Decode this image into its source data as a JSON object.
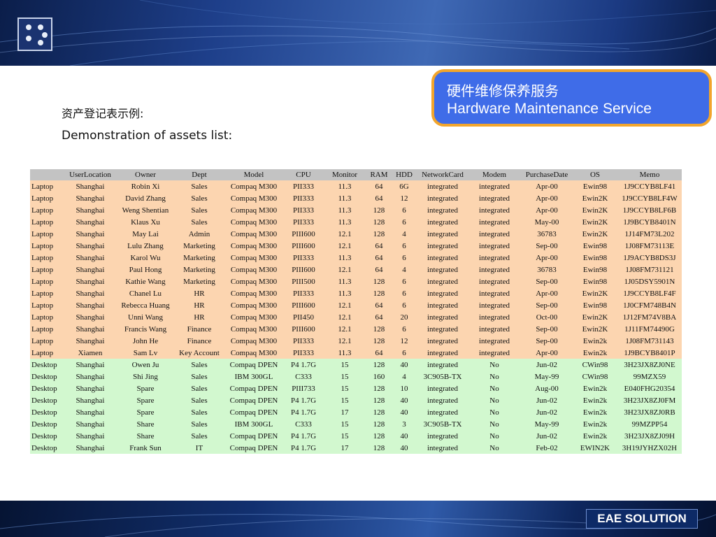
{
  "badge": {
    "title_cn": "硬件维修保养服务",
    "title_en": "Hardware Maintenance Service"
  },
  "intro": {
    "title_cn": "资产登记表示例:",
    "title_en": "Demonstration of assets list:"
  },
  "footer": {
    "brand": "EAE SOLUTION"
  },
  "colors": {
    "laptop_row": "#fcd5b0",
    "desktop_row": "#d2f8cf",
    "header_row": "#c3c3c3",
    "badge_bg": "#3f6ce8",
    "badge_border": "#f2a52c"
  },
  "table": {
    "headers": [
      "",
      "UserLocation",
      "Owner",
      "Dept",
      "Model",
      "CPU",
      "Monitor",
      "RAM",
      "HDD",
      "NetworkCard",
      "Modem",
      "PurchaseDate",
      "OS",
      "Memo"
    ],
    "rows": [
      [
        "Laptop",
        "Shanghai",
        "Robin Xi",
        "Sales",
        "Compaq M300",
        "PII333",
        "11.3",
        "64",
        "6G",
        "integrated",
        "integrated",
        "Apr-00",
        "Ewin98",
        "1J9CCYB8LF41"
      ],
      [
        "Laptop",
        "Shanghai",
        "David Zhang",
        "Sales",
        "Compaq M300",
        "PII333",
        "11.3",
        "64",
        "12",
        "integrated",
        "integrated",
        "Apr-00",
        "Ewin2K",
        "1J9CCYB8LF4W"
      ],
      [
        "Laptop",
        "Shanghai",
        "Weng Shentian",
        "Sales",
        "Compaq M300",
        "PII333",
        "11.3",
        "128",
        "6",
        "integrated",
        "integrated",
        "Apr-00",
        "Ewin2K",
        "1J9CCYB8LF6B"
      ],
      [
        "Laptop",
        "Shanghai",
        "Klaus Xu",
        "Sales",
        "Compaq M300",
        "PII333",
        "11.3",
        "128",
        "6",
        "integrated",
        "integrated",
        "May-00",
        "Ewin2K",
        "1J9BCYB8401N"
      ],
      [
        "Laptop",
        "Shanghai",
        "May Lai",
        "Admin",
        "Compaq M300",
        "PIII600",
        "12.1",
        "128",
        "4",
        "integrated",
        "integrated",
        "36783",
        "Ewin2K",
        "1J14FM73L202"
      ],
      [
        "Laptop",
        "Shanghai",
        "Lulu Zhang",
        "Marketing",
        "Compaq M300",
        "PIII600",
        "12.1",
        "64",
        "6",
        "integrated",
        "integrated",
        "Sep-00",
        "Ewin98",
        "1J08FM73113E"
      ],
      [
        "Laptop",
        "Shanghai",
        "Karol Wu",
        "Marketing",
        "Compaq M300",
        "PII333",
        "11.3",
        "64",
        "6",
        "integrated",
        "integrated",
        "Apr-00",
        "Ewin98",
        "1J9ACYB8DS3J"
      ],
      [
        "Laptop",
        "Shanghai",
        "Paul Hong",
        "Marketing",
        "Compaq M300",
        "PIII600",
        "12.1",
        "64",
        "4",
        "integrated",
        "integrated",
        "36783",
        "Ewin98",
        "1J08FM731121"
      ],
      [
        "Laptop",
        "Shanghai",
        "Kathie Wang",
        "Marketing",
        "Compaq M300",
        "PIII500",
        "11.3",
        "128",
        "6",
        "integrated",
        "integrated",
        "Sep-00",
        "Ewin98",
        "1J05DSY5901N"
      ],
      [
        "Laptop",
        "Shanghai",
        "Chanel Lu",
        "HR",
        "Compaq M300",
        "PII333",
        "11.3",
        "128",
        "6",
        "integrated",
        "integrated",
        "Apr-00",
        "Ewin2K",
        "1J9CCYB8LF4F"
      ],
      [
        "Laptop",
        "Shanghai",
        "Rebecca Huang",
        "HR",
        "Compaq M300",
        "PIII600",
        "12.1",
        "64",
        "6",
        "integrated",
        "integrated",
        "Sep-00",
        "Ewin98",
        "1J0CFM748B4N"
      ],
      [
        "Laptop",
        "Shanghai",
        "Unni Wang",
        "HR",
        "Compaq M300",
        "PII450",
        "12.1",
        "64",
        "20",
        "integrated",
        "integrated",
        "Oct-00",
        "Ewin2K",
        "1J12FM74V8BA"
      ],
      [
        "Laptop",
        "Shanghai",
        "Francis Wang",
        "Finance",
        "Compaq M300",
        "PIII600",
        "12.1",
        "128",
        "6",
        "integrated",
        "integrated",
        "Sep-00",
        "Ewin2K",
        "1J11FM74490G"
      ],
      [
        "Laptop",
        "Shanghai",
        "John He",
        "Finance",
        "Compaq M300",
        "PII333",
        "12.1",
        "128",
        "12",
        "integrated",
        "integrated",
        "Sep-00",
        "Ewin2k",
        "1J08FM731143"
      ],
      [
        "Laptop",
        "Xiamen",
        "Sam Lv",
        "Key Account",
        "Compaq M300",
        "PII333",
        "11.3",
        "64",
        "6",
        "integrated",
        "integrated",
        "Apr-00",
        "Ewin2k",
        "1J9BCYB8401P"
      ],
      [
        "Desktop",
        "Shanghai",
        "Owen Ju",
        "Sales",
        "Compaq DPEN",
        "P4 1.7G",
        "15",
        "128",
        "40",
        "integrated",
        "No",
        "Jun-02",
        "CWin98",
        "3H23JX8ZJ0NE"
      ],
      [
        "Desktop",
        "Shanghai",
        "Shi Jing",
        "Sales",
        "IBM 300GL",
        "C333",
        "15",
        "160",
        "4",
        "3C905B-TX",
        "No",
        "May-99",
        "CWin98",
        "99MZX59"
      ],
      [
        "Desktop",
        "Shanghai",
        "Spare",
        "Sales",
        "Compaq DPEN",
        "PIII733",
        "15",
        "128",
        "10",
        "integrated",
        "No",
        "Aug-00",
        "Ewin2k",
        "E040FHG20354"
      ],
      [
        "Desktop",
        "Shanghai",
        "Spare",
        "Sales",
        "Compaq DPEN",
        "P4 1.7G",
        "15",
        "128",
        "40",
        "integrated",
        "No",
        "Jun-02",
        "Ewin2k",
        "3H23JX8ZJ0FM"
      ],
      [
        "Desktop",
        "Shanghai",
        "Spare",
        "Sales",
        "Compaq DPEN",
        "P4 1.7G",
        "17",
        "128",
        "40",
        "integrated",
        "No",
        "Jun-02",
        "Ewin2k",
        "3H23JX8ZJ0RB"
      ],
      [
        "Desktop",
        "Shanghai",
        "Share",
        "Sales",
        "IBM 300GL",
        "C333",
        "15",
        "128",
        "3",
        "3C905B-TX",
        "No",
        "May-99",
        "Ewin2k",
        "99MZPP54"
      ],
      [
        "Desktop",
        "Shanghai",
        "Share",
        "Sales",
        "Compaq DPEN",
        "P4 1.7G",
        "15",
        "128",
        "40",
        "integrated",
        "No",
        "Jun-02",
        "Ewin2k",
        "3H23JX8ZJ09H"
      ],
      [
        "Desktop",
        "Shanghai",
        "Frank Sun",
        "IT",
        "Compaq DPEN",
        "P4 1.7G",
        "17",
        "128",
        "40",
        "integrated",
        "No",
        "Feb-02",
        "EWIN2K",
        "3H19JYHZX02H"
      ]
    ]
  }
}
